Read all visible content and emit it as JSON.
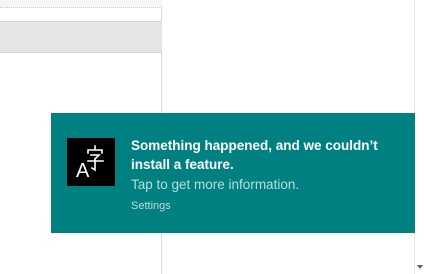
{
  "toast": {
    "title": "Something happened, and we couldn’t install a feature.",
    "subtitle": "Tap to get more information.",
    "source": "Settings",
    "icon": "language-icon",
    "background": "#008080"
  }
}
